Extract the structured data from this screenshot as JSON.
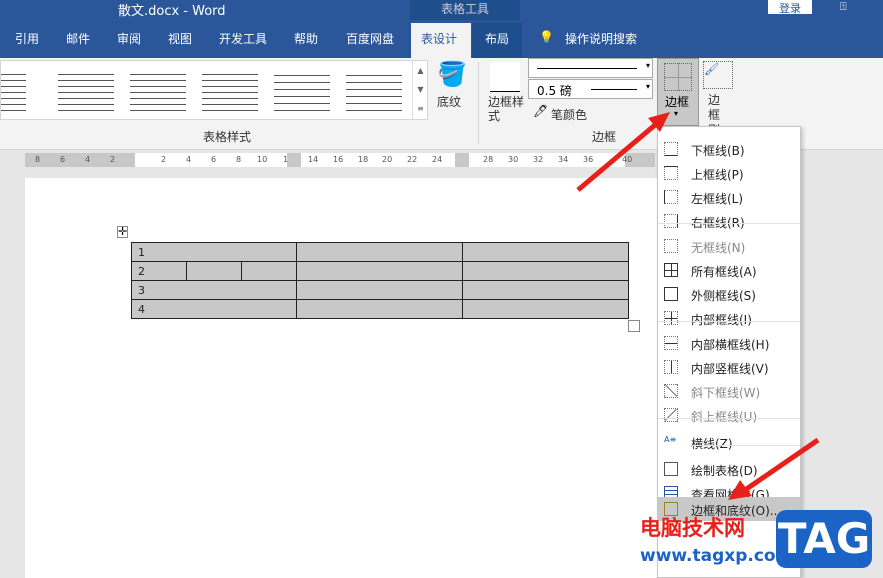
{
  "titlebar": {
    "title": "散文.docx  -  Word",
    "context_tab": "表格工具",
    "login": "登录"
  },
  "tabs": [
    "引用",
    "邮件",
    "审阅",
    "视图",
    "开发工具",
    "帮助",
    "百度网盘",
    "表设计",
    "布局"
  ],
  "tell_me": "操作说明搜索",
  "ribbon": {
    "shading": "底纹",
    "border_styles": "边框样式",
    "pen_weight": "0.5 磅",
    "pen_color": "笔颜色",
    "borders": "边框",
    "border_painter": "边框刷",
    "group_table_styles": "表格样式",
    "group_borders": "边框"
  },
  "ruler": [
    "8",
    "6",
    "4",
    "2",
    "2",
    "4",
    "6",
    "8",
    "10",
    "1",
    "14",
    "16",
    "18",
    "20",
    "22",
    "24",
    "28",
    "30",
    "32",
    "34",
    "36",
    "40"
  ],
  "table": {
    "rows": [
      "1",
      "2",
      "3",
      "4"
    ]
  },
  "menu": {
    "items": [
      "下框线(B)",
      "上框线(P)",
      "左框线(L)",
      "右框线(R)",
      "无框线(N)",
      "所有框线(A)",
      "外侧框线(S)",
      "内部框线(I)",
      "内部横框线(H)",
      "内部竖框线(V)",
      "斜下框线(W)",
      "斜上框线(U)",
      "横线(Z)",
      "绘制表格(D)",
      "查看网格线(G)",
      "边框和底纹(O)..."
    ]
  },
  "watermark": {
    "site": "电脑技术网",
    "url": "www.tagxp.com",
    "tag": "TAG"
  }
}
